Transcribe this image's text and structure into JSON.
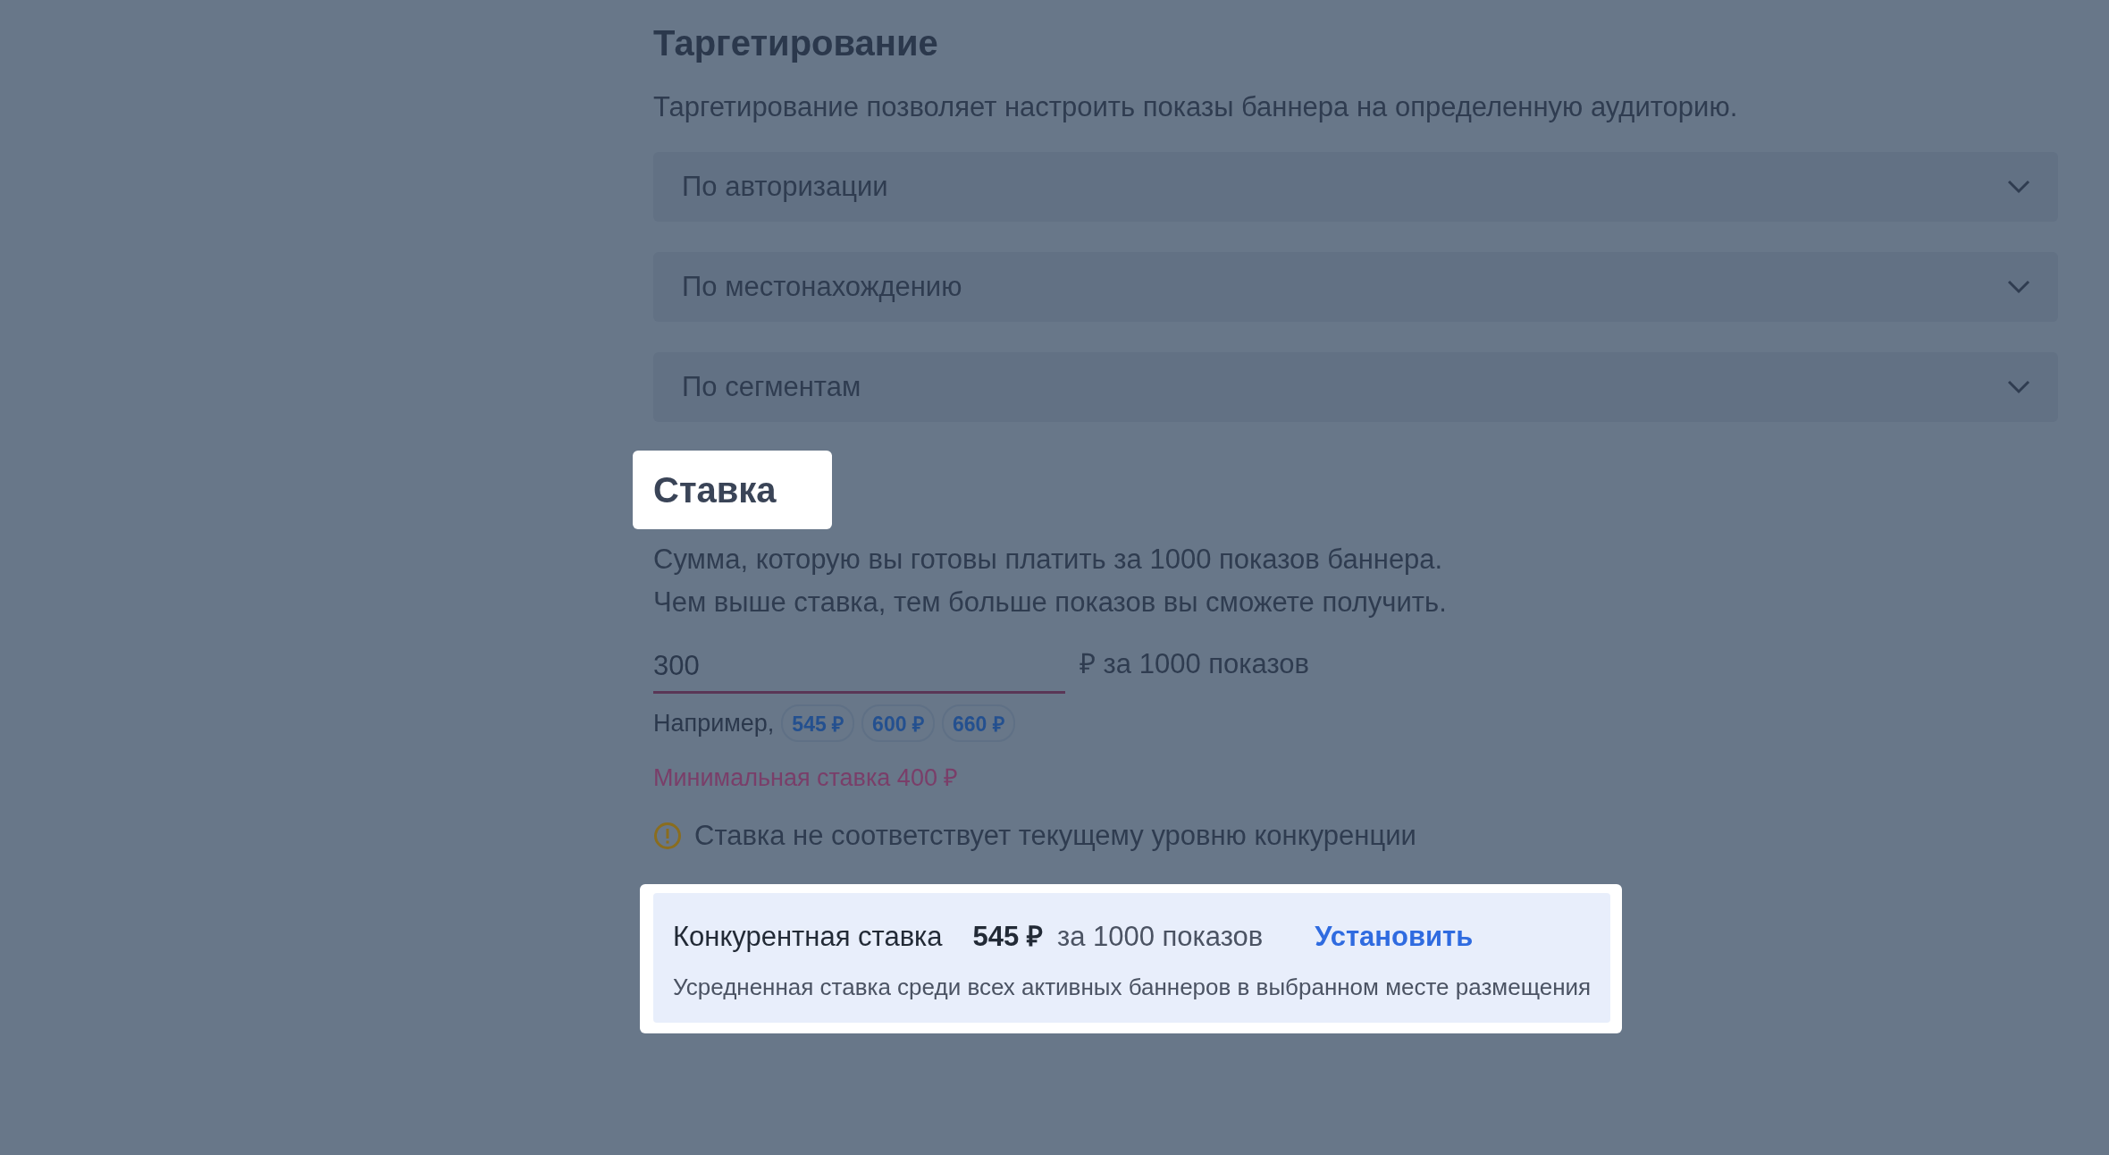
{
  "targeting": {
    "title": "Таргетирование",
    "description": "Таргетирование позволяет настроить показы баннера на определенную аудиторию.",
    "filters": [
      {
        "label": "По авторизации",
        "expanded": false
      },
      {
        "label": "По местонахождению",
        "expanded": false
      },
      {
        "label": "По сегментам",
        "expanded": false
      }
    ]
  },
  "bid": {
    "title": "Ставка",
    "title_highlighted": true,
    "description": [
      "Сумма, которую вы готовы платить за 1000 показов баннера.",
      "Чем выше ставка, тем больше показов вы сможете получить."
    ],
    "input": {
      "value": "300",
      "suffix": "₽ за 1000 показов"
    },
    "examples_label": "Например,",
    "examples": [
      "545 ₽",
      "600 ₽",
      "660 ₽"
    ],
    "min_error": "Минимальная ставка 400 ₽",
    "warning": "Ставка не соответствует текущему уровню конкуренции",
    "competitive": {
      "highlighted": true,
      "label": "Конкурентная ставка",
      "amount": "545 ₽",
      "suffix": "за 1000 показов",
      "action": "Установить",
      "note": "Усредненная ставка среди всех активных баннеров в выбранном месте размещения"
    }
  }
}
